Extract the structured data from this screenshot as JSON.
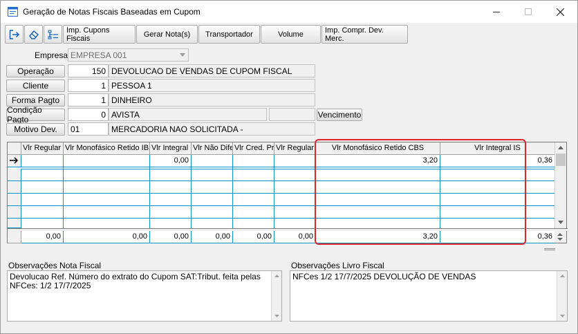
{
  "window": {
    "title": "Geração de Notas Fiscais Baseadas em Cupom"
  },
  "toolbar": {
    "icons": [
      "exit-icon",
      "eraser-icon",
      "list-config-icon"
    ],
    "buttons": [
      "Imp. Cupons Fiscais",
      "Gerar Nota(s)",
      "Transportador",
      "Volume",
      "Imp. Compr. Dev. Merc."
    ]
  },
  "form": {
    "empresa_label": "Empresa",
    "empresa_value": "EMPRESA 001",
    "operacao": {
      "label": "Operação",
      "code": "150",
      "desc": "DEVOLUCAO DE VENDAS DE CUPOM FISCAL"
    },
    "cliente": {
      "label": "Cliente",
      "code": "1",
      "desc": "PESSOA 1"
    },
    "forma_pagto": {
      "label": "Forma Pagto",
      "code": "1",
      "desc": "DINHEIRO"
    },
    "condicao_pagto": {
      "label": "Condição Pagto",
      "code": "0",
      "desc": "AVISTA",
      "extra": "",
      "button": "Vencimento"
    },
    "motivo_dev": {
      "label": "Motivo Dev.",
      "code": "01",
      "desc": "MERCADORIA NAO SOLICITADA -"
    }
  },
  "grid": {
    "columns": [
      "Vlr Regular",
      "Vlr Monofásico Retido IBS",
      "Vlr Integral I",
      "Vlr Não Dife",
      "Vlr Cred. Pr",
      "Vlr Regular",
      "Vlr Monofásico Retido CBS",
      "Vlr Integral IS"
    ],
    "row1": [
      "",
      "",
      "0,00",
      "",
      "",
      "",
      "3,20",
      "0,36"
    ],
    "totals": [
      "0,00",
      "0,00",
      "0,00",
      "0,00",
      "0,00",
      "0,00",
      "3,20",
      "0,36"
    ]
  },
  "observacoes": {
    "nota_label": "Observações Nota Fiscal",
    "nota_text": "Devolucao Ref. Número do extrato do Cupom SAT:Tribut. feita pelas NFCes: 1/2 17/7/2025",
    "livro_label": "Observações Livro Fiscal",
    "livro_text": "NFCes 1/2 17/7/2025 DEVOLUÇÃO DE VENDAS"
  },
  "colors": {
    "highlight": "#e0242e",
    "grid_line": "#0095c8"
  }
}
